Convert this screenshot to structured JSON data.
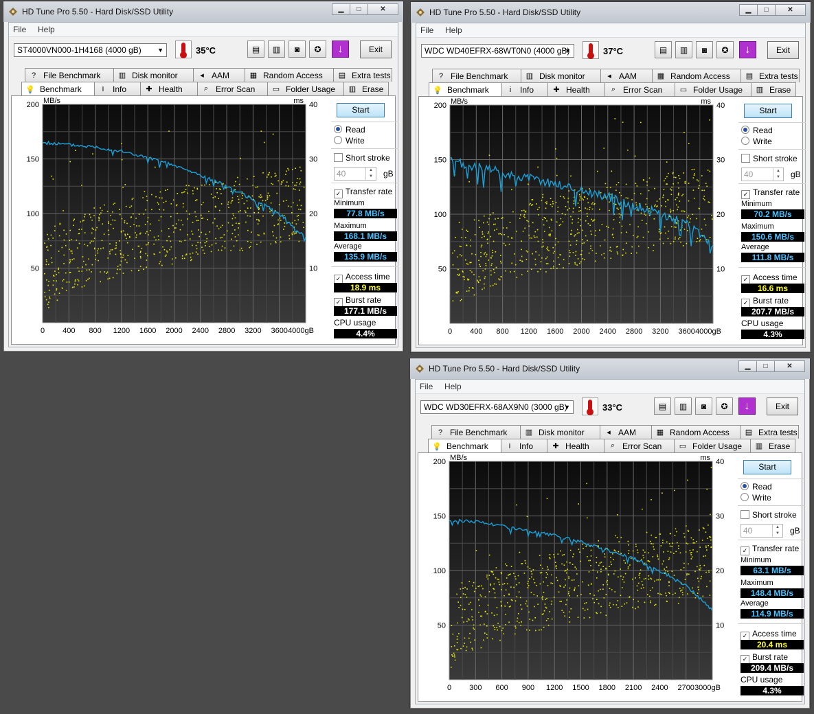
{
  "common": {
    "title": "HD Tune Pro 5.50 - Hard Disk/SSD Utility",
    "menu_file": "File",
    "menu_help": "Help",
    "exit_label": "Exit",
    "tabs_top": [
      "File Benchmark",
      "Disk monitor",
      "AAM",
      "Random Access",
      "Extra tests"
    ],
    "tabs_bottom": [
      "Benchmark",
      "Info",
      "Health",
      "Error Scan",
      "Folder Usage",
      "Erase"
    ],
    "start_label": "Start",
    "read_label": "Read",
    "write_label": "Write",
    "short_stroke_label": "Short stroke",
    "short_stroke_value": "40",
    "gb_unit": "gB",
    "transfer_rate_label": "Transfer rate",
    "minimum_label": "Minimum",
    "maximum_label": "Maximum",
    "average_label": "Average",
    "access_time_label": "Access time",
    "burst_rate_label": "Burst rate",
    "cpu_usage_label": "CPU usage",
    "y_left_unit": "MB/s",
    "y_right_unit": "ms",
    "colors": {
      "transfer_line": "#1aa0d8",
      "access_dots": "#e8e800",
      "chart_bg": "#1a1a1a"
    }
  },
  "windows": [
    {
      "drive": "ST4000VN000-1H4168 (4000 gB)",
      "temperature": "35°C",
      "minimum": "77.8 MB/s",
      "maximum": "168.1 MB/s",
      "average": "135.9 MB/s",
      "access_time": "18.9 ms",
      "burst_rate": "177.1 MB/s",
      "cpu_usage": "4.4%",
      "chart_data": {
        "type": "line",
        "x_ticks": [
          "0",
          "400",
          "800",
          "1200",
          "1600",
          "2000",
          "2400",
          "2800",
          "3200",
          "3600",
          "4000gB"
        ],
        "y_left_ticks": [
          "200",
          "150",
          "100",
          "50"
        ],
        "y_right_ticks": [
          "40",
          "30",
          "20",
          "10"
        ],
        "xlim": [
          0,
          4000
        ],
        "ylim": [
          0,
          200
        ],
        "y2lim": [
          0,
          40
        ],
        "series": [
          {
            "x": [
              0,
              400,
              800,
              1200,
              1600,
              2000,
              2400,
              2800,
              3200,
              3600,
              4000
            ],
            "y": [
              165,
              163,
              161,
              157,
              151,
              144,
              135,
              125,
              113,
              100,
              78
            ]
          }
        ]
      }
    },
    {
      "drive": "WDC WD40EFRX-68WT0N0 (4000 gB)",
      "temperature": "37°C",
      "minimum": "70.2 MB/s",
      "maximum": "150.6 MB/s",
      "average": "111.8 MB/s",
      "access_time": "16.6 ms",
      "burst_rate": "207.7 MB/s",
      "cpu_usage": "4.3%",
      "chart_data": {
        "type": "line",
        "x_ticks": [
          "0",
          "400",
          "800",
          "1200",
          "1600",
          "2000",
          "2400",
          "2800",
          "3200",
          "3600",
          "4000gB"
        ],
        "y_left_ticks": [
          "200",
          "150",
          "100",
          "50"
        ],
        "y_right_ticks": [
          "40",
          "30",
          "20",
          "10"
        ],
        "xlim": [
          0,
          4000
        ],
        "ylim": [
          0,
          200
        ],
        "y2lim": [
          0,
          40
        ],
        "series": [
          {
            "x": [
              0,
              400,
              800,
              1200,
              1600,
              2000,
              2400,
              2800,
              3200,
              3600,
              4000
            ],
            "y": [
              148,
              143,
              138,
              133,
              128,
              122,
              116,
              108,
              100,
              90,
              72
            ]
          }
        ]
      }
    },
    {
      "drive": "WDC WD30EFRX-68AX9N0 (3000 gB)",
      "temperature": "33°C",
      "minimum": "63.1 MB/s",
      "maximum": "148.4 MB/s",
      "average": "114.9 MB/s",
      "access_time": "20.4 ms",
      "burst_rate": "209.4 MB/s",
      "cpu_usage": "4.3%",
      "chart_data": {
        "type": "line",
        "x_ticks": [
          "0",
          "300",
          "600",
          "900",
          "1200",
          "1500",
          "1800",
          "2100",
          "2400",
          "2700",
          "3000gB"
        ],
        "y_left_ticks": [
          "200",
          "150",
          "100",
          "50"
        ],
        "y_right_ticks": [
          "40",
          "30",
          "20",
          "10"
        ],
        "xlim": [
          0,
          3000
        ],
        "ylim": [
          0,
          200
        ],
        "y2lim": [
          0,
          40
        ],
        "series": [
          {
            "x": [
              0,
              300,
              600,
              900,
              1200,
              1500,
              1800,
              2100,
              2400,
              2700,
              3000
            ],
            "y": [
              146,
              145,
              141,
              136,
              132,
              126,
              119,
              111,
              100,
              86,
              64
            ]
          }
        ]
      }
    }
  ]
}
